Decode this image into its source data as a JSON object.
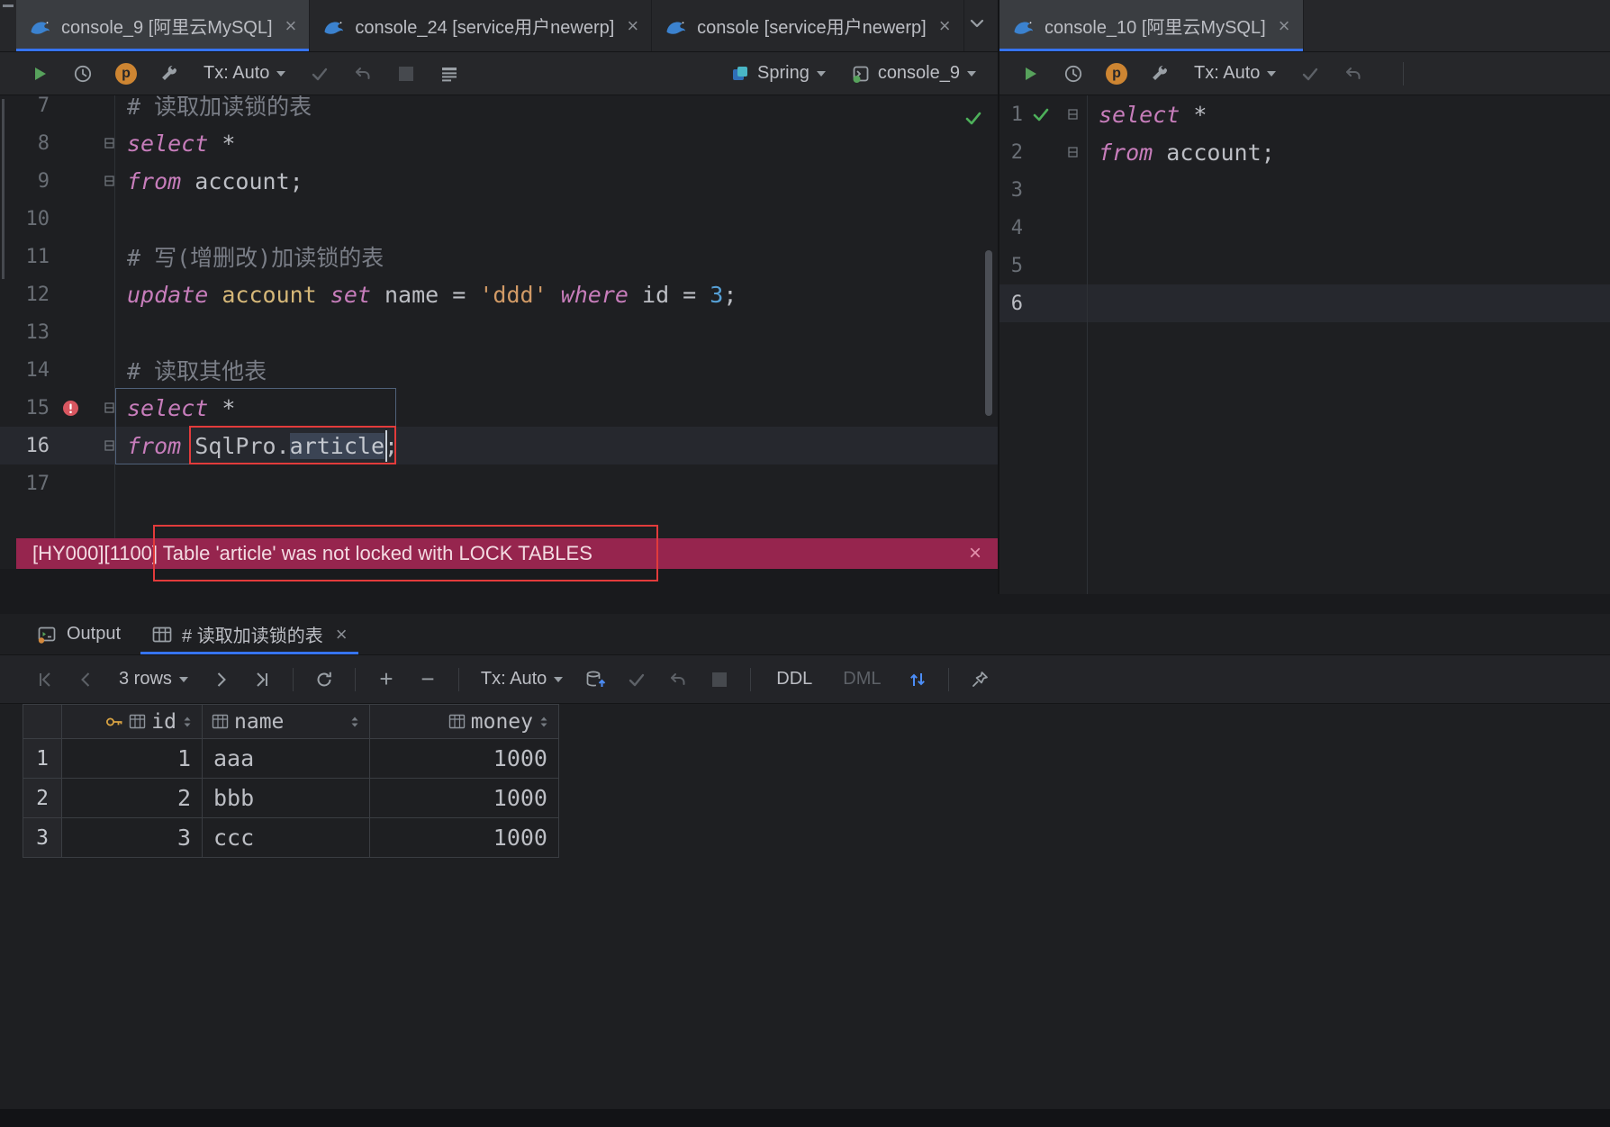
{
  "icons": {
    "close": "×",
    "profiler": "p",
    "plus": "+",
    "minus": "−"
  },
  "colors": {
    "accent": "#3674f0",
    "error_banner_bg": "#96254e",
    "annotation_red": "#e23b3b",
    "run_green": "#57a25c",
    "keyword_pink": "#c77dbb"
  },
  "tab_bars": {
    "left": [
      {
        "label": "console_9 [阿里云MySQL]",
        "active": true
      },
      {
        "label": "console_24 [service用户newerp]",
        "active": false
      },
      {
        "label": "console [service用户newerp]",
        "active": false
      }
    ],
    "right": [
      {
        "label": "console_10 [阿里云MySQL]",
        "active": true
      }
    ]
  },
  "toolbar_left": {
    "tx": "Tx: Auto",
    "spring": "Spring",
    "console": "console_9"
  },
  "toolbar_right": {
    "tx": "Tx: Auto"
  },
  "editor_left": {
    "lines": [
      {
        "n": 7,
        "seg": [
          {
            "s": "cmt",
            "t": "# 读取加读锁的表"
          }
        ]
      },
      {
        "n": 8,
        "fold": true,
        "seg": [
          {
            "s": "kw",
            "t": "select"
          },
          {
            "s": "pl",
            "t": " *"
          }
        ]
      },
      {
        "n": 9,
        "fold": true,
        "seg": [
          {
            "s": "kw",
            "t": "from"
          },
          {
            "s": "pl",
            "t": " account;"
          }
        ]
      },
      {
        "n": 10,
        "seg": []
      },
      {
        "n": 11,
        "seg": [
          {
            "s": "cmt",
            "t": "# 写(增删改)加读锁的表"
          }
        ]
      },
      {
        "n": 12,
        "seg": [
          {
            "s": "kw",
            "t": "update"
          },
          {
            "s": "pl",
            "t": " "
          },
          {
            "s": "tbl",
            "t": "account"
          },
          {
            "s": "pl",
            "t": " "
          },
          {
            "s": "kw",
            "t": "set"
          },
          {
            "s": "pl",
            "t": " name = "
          },
          {
            "s": "str",
            "t": "'ddd'"
          },
          {
            "s": "pl",
            "t": " "
          },
          {
            "s": "kw",
            "t": "where"
          },
          {
            "s": "pl",
            "t": " id = "
          },
          {
            "s": "num",
            "t": "3"
          },
          {
            "s": "pl",
            "t": ";"
          }
        ]
      },
      {
        "n": 13,
        "seg": []
      },
      {
        "n": 14,
        "seg": [
          {
            "s": "cmt",
            "t": "# 读取其他表"
          }
        ]
      },
      {
        "n": 15,
        "mark": "error",
        "fold": true,
        "seg": [
          {
            "s": "kw",
            "t": "select"
          },
          {
            "s": "pl",
            "t": " *"
          }
        ]
      },
      {
        "n": 16,
        "current": true,
        "fold": true,
        "seg": [
          {
            "s": "kw",
            "t": "from"
          },
          {
            "s": "pl",
            "t": " "
          },
          {
            "s": "pl",
            "t": "SqlPro."
          },
          {
            "s": "sel",
            "t": "article"
          },
          {
            "s": "pl",
            "t": ";"
          }
        ]
      },
      {
        "n": 17,
        "seg": []
      }
    ]
  },
  "editor_right": {
    "lines": [
      {
        "n": 1,
        "mark": "check",
        "fold": true,
        "seg": [
          {
            "s": "kw",
            "t": "select"
          },
          {
            "s": "pl",
            "t": " *"
          }
        ]
      },
      {
        "n": 2,
        "fold": true,
        "seg": [
          {
            "s": "kw",
            "t": "from"
          },
          {
            "s": "pl",
            "t": " account;"
          }
        ]
      },
      {
        "n": 3,
        "seg": []
      },
      {
        "n": 4,
        "seg": []
      },
      {
        "n": 5,
        "seg": []
      },
      {
        "n": 6,
        "current": true,
        "seg": []
      }
    ]
  },
  "error_banner": {
    "text": "[HY000][1100] Table 'article' was not locked with LOCK TABLES"
  },
  "bottom_panel": {
    "tabs": [
      {
        "label": "Output",
        "active": false
      },
      {
        "label": "# 读取加读锁的表",
        "active": true
      }
    ],
    "toolbar": {
      "rows": "3 rows",
      "tx": "Tx: Auto",
      "ddl": "DDL",
      "dml": "DML"
    },
    "result_table": {
      "columns": [
        "id",
        "name",
        "money"
      ],
      "rows": [
        [
          "1",
          "aaa",
          "1000"
        ],
        [
          "2",
          "bbb",
          "1000"
        ],
        [
          "3",
          "ccc",
          "1000"
        ]
      ]
    }
  }
}
